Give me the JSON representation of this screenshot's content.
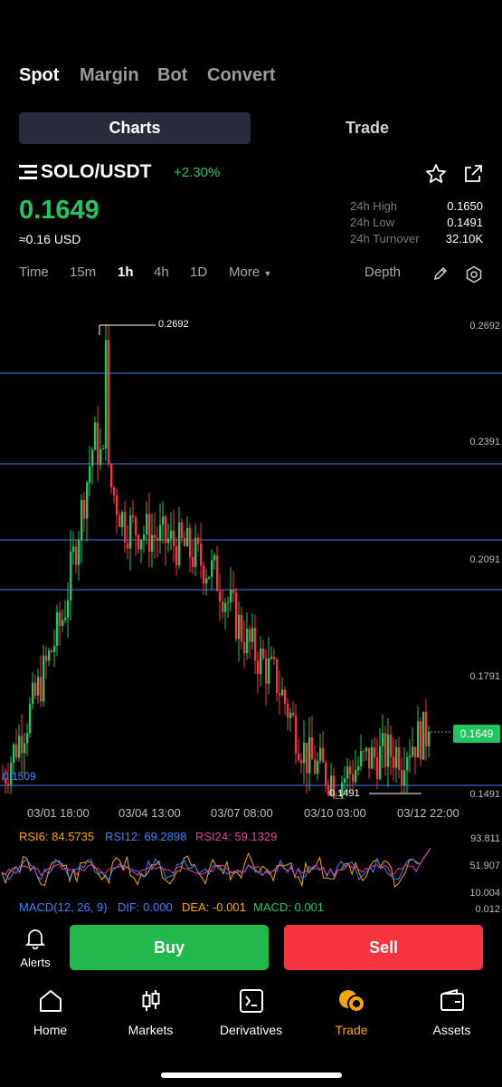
{
  "top_tabs": [
    "Spot",
    "Margin",
    "Bot",
    "Convert"
  ],
  "segments": {
    "charts": "Charts",
    "trade": "Trade"
  },
  "pair": {
    "symbol": "SOLO/USDT",
    "change": "+2.30%",
    "price": "0.1649",
    "usd": "≈0.16 USD"
  },
  "stats": {
    "high_label": "24h High",
    "high_value": "0.1650",
    "low_label": "24h Low",
    "low_value": "0.1491",
    "turnover_label": "24h Turnover",
    "turnover_value": "32.10K"
  },
  "timeframes": [
    "Time",
    "15m",
    "1h",
    "4h",
    "1D"
  ],
  "more_label": "More",
  "depth_label": "Depth",
  "chart": {
    "y_labels": [
      "0.2692",
      "0.2391",
      "0.2091",
      "0.1791",
      "0.1491"
    ],
    "current_price": "0.1649",
    "max_marker": "0.2692",
    "min_marker": "0.1491",
    "left_marker": "0.1509",
    "x_labels": [
      "03/01 18:00",
      "03/04 13:00",
      "03/07 08:00",
      "03/10 03:00",
      "03/12 22:00"
    ]
  },
  "chart_data": {
    "type": "candlestick",
    "y_range": [
      0.1491,
      0.2692
    ],
    "x": [
      "03/01 18:00",
      "03/04 13:00",
      "03/07 08:00",
      "03/10 03:00",
      "03/12 22:00"
    ],
    "close_trace": [
      0.153,
      0.172,
      0.195,
      0.24,
      0.218,
      0.215,
      0.212,
      0.205,
      0.188,
      0.178,
      0.158,
      0.152,
      0.158,
      0.16,
      0.1649
    ],
    "high": 0.2692,
    "low": 0.1491,
    "last": 0.1649
  },
  "rsi": {
    "rsi6": "RSI6: 84.5735",
    "rsi12": "RSI12: 69.2898",
    "rsi24": "RSI24: 59.1329",
    "axis": [
      "93.811",
      "51.907",
      "10.004"
    ]
  },
  "macd": {
    "title": "MACD(12, 26, 9)",
    "dif": "DIF: 0.000",
    "dea": "DEA: -0.001",
    "macd": "MACD: 0.001",
    "axis": "0.012"
  },
  "alerts_label": "Alerts",
  "buy_label": "Buy",
  "sell_label": "Sell",
  "nav": [
    "Home",
    "Markets",
    "Derivatives",
    "Trade",
    "Assets"
  ],
  "colors": {
    "green": "#22c55e",
    "red": "#f6343f",
    "blue": "#3b82f6",
    "accent": "#f7a600"
  }
}
